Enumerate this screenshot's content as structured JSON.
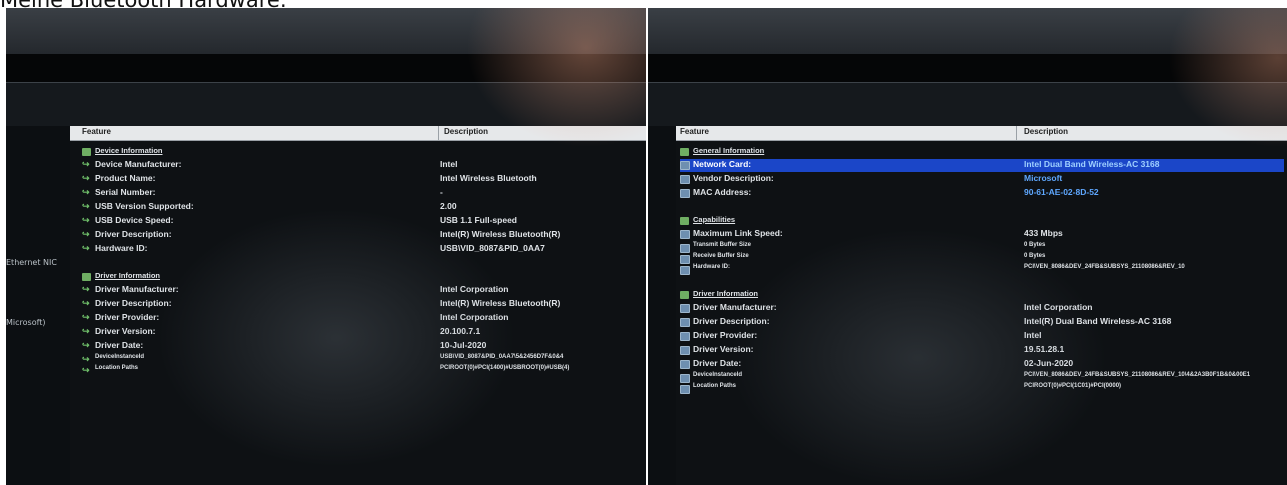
{
  "heading": "Meine Bluetooth Hardware:",
  "left": {
    "pane_labels": [
      "Ethernet NIC",
      "Microsoft)"
    ],
    "col_feature": "Feature",
    "col_description": "Description",
    "rows": [
      {
        "label": "Device Information",
        "value": "",
        "kind": "section"
      },
      {
        "label": "Device Manufacturer:",
        "value": "Intel",
        "kind": "normal"
      },
      {
        "label": "Product Name:",
        "value": "Intel Wireless Bluetooth",
        "kind": "normal"
      },
      {
        "label": "Serial Number:",
        "value": "-",
        "kind": "normal"
      },
      {
        "label": "USB Version Supported:",
        "value": "2.00",
        "kind": "normal"
      },
      {
        "label": "USB Device Speed:",
        "value": "USB 1.1 Full-speed",
        "kind": "normal"
      },
      {
        "label": "Driver Description:",
        "value": "Intel(R) Wireless Bluetooth(R)",
        "kind": "normal"
      },
      {
        "label": "Hardware ID:",
        "value": "USB\\VID_8087&PID_0AA7",
        "kind": "normal"
      },
      {
        "label": "",
        "value": "",
        "kind": "spacer"
      },
      {
        "label": "Driver Information",
        "value": "",
        "kind": "section"
      },
      {
        "label": "Driver Manufacturer:",
        "value": "Intel Corporation",
        "kind": "normal"
      },
      {
        "label": "Driver Description:",
        "value": "Intel(R) Wireless Bluetooth(R)",
        "kind": "normal"
      },
      {
        "label": "Driver Provider:",
        "value": "Intel Corporation",
        "kind": "normal"
      },
      {
        "label": "Driver Version:",
        "value": "20.100.7.1",
        "kind": "normal"
      },
      {
        "label": "Driver Date:",
        "value": "10-Jul-2020",
        "kind": "normal"
      },
      {
        "label": "DeviceInstanceId",
        "value": "USB\\VID_8087&PID_0AA7\\5&2456D7F&0&4",
        "kind": "small"
      },
      {
        "label": "Location Paths",
        "value": "PCIROOT(0)#PCI(1400)#USBROOT(0)#USB(4)",
        "kind": "small"
      }
    ]
  },
  "right": {
    "col_feature": "Feature",
    "col_description": "Description",
    "rows": [
      {
        "label": "General Information",
        "value": "",
        "kind": "section"
      },
      {
        "label": "Network Card:",
        "value": "Intel Dual Band Wireless-AC 3168",
        "kind": "selected"
      },
      {
        "label": "Vendor Description:",
        "value": "Microsoft",
        "kind": "blue"
      },
      {
        "label": "MAC Address:",
        "value": "90-61-AE-02-8D-52",
        "kind": "blue"
      },
      {
        "label": "",
        "value": "",
        "kind": "spacer"
      },
      {
        "label": "Capabilities",
        "value": "",
        "kind": "section"
      },
      {
        "label": "Maximum Link Speed:",
        "value": "433 Mbps",
        "kind": "normal"
      },
      {
        "label": "Transmit Buffer Size",
        "value": "0 Bytes",
        "kind": "small"
      },
      {
        "label": "Receive Buffer Size",
        "value": "0 Bytes",
        "kind": "small"
      },
      {
        "label": "Hardware ID:",
        "value": "PCI\\VEN_8086&DEV_24FB&SUBSYS_21108086&REV_10",
        "kind": "small"
      },
      {
        "label": "",
        "value": "",
        "kind": "spacer"
      },
      {
        "label": "Driver Information",
        "value": "",
        "kind": "section"
      },
      {
        "label": "Driver Manufacturer:",
        "value": "Intel Corporation",
        "kind": "normal"
      },
      {
        "label": "Driver Description:",
        "value": "Intel(R) Dual Band Wireless-AC 3168",
        "kind": "normal"
      },
      {
        "label": "Driver Provider:",
        "value": "Intel",
        "kind": "normal"
      },
      {
        "label": "Driver Version:",
        "value": "19.51.28.1",
        "kind": "normal"
      },
      {
        "label": "Driver Date:",
        "value": "02-Jun-2020",
        "kind": "normal"
      },
      {
        "label": "DeviceInstanceId",
        "value": "PCI\\VEN_8086&DEV_24FB&SUBSYS_21108086&REV_10\\4&2A3B0F1B&0&00E1",
        "kind": "small"
      },
      {
        "label": "Location Paths",
        "value": "PCIROOT(0)#PCI(1C01)#PCI(0000)",
        "kind": "small"
      }
    ]
  }
}
